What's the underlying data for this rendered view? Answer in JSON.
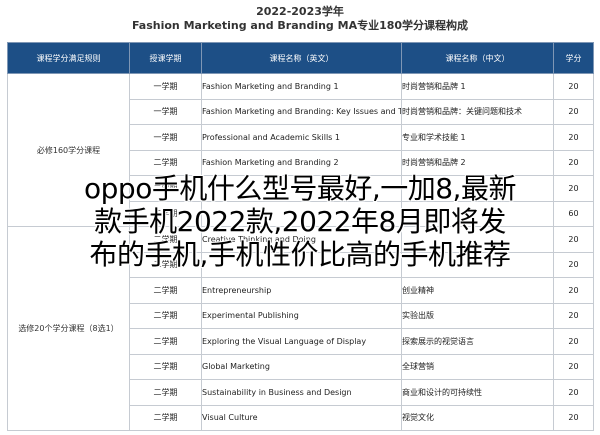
{
  "title": {
    "year": "2022-2023学年",
    "main": "Fashion Marketing and Branding MA专业180学分课程构成"
  },
  "table": {
    "headers": [
      "课程学分满足规则",
      "授课学期",
      "课程名称（英文）",
      "课程名称（中文）",
      "学分"
    ],
    "group1_label": "必修160学分课程",
    "group2_label": "选修20个学分课程（8选1）",
    "rows": [
      {
        "sem": "一学期",
        "en": "Fashion Marketing and Branding 1",
        "cn": "时尚营销和品牌 1",
        "credits": "20"
      },
      {
        "sem": "一学期",
        "en": "Fashion Marketing and Branding: Key Issues and Techniques",
        "cn": "时尚营销和品牌：关键问题和技术",
        "credits": "20"
      },
      {
        "sem": "一学期",
        "en": "Professional and Academic Skills 1",
        "cn": "专业和学术技能 1",
        "credits": "20"
      },
      {
        "sem": "二学期",
        "en": "Fashion Marketing and Branding 2",
        "cn": "时尚营销和品牌 2",
        "credits": "20"
      },
      {
        "sem": "二学期",
        "en": "",
        "cn": "",
        "credits": "20"
      },
      {
        "sem": "二学期",
        "en": "",
        "cn": "",
        "credits": "60"
      },
      {
        "sem": "二学期",
        "en": "Creative Thinking and Doing",
        "cn": "",
        "credits": "20"
      },
      {
        "sem": "二学期",
        "en": "",
        "cn": "",
        "credits": "20"
      },
      {
        "sem": "二学期",
        "en": "Entrepreneurship",
        "cn": "创业精神",
        "credits": "20"
      },
      {
        "sem": "二学期",
        "en": "Experimental Publishing",
        "cn": "实验出版",
        "credits": "20"
      },
      {
        "sem": "二学期",
        "en": "Exploring the Visual Language of Display",
        "cn": "探索展示的视觉语言",
        "credits": "20"
      },
      {
        "sem": "二学期",
        "en": "Global Marketing",
        "cn": "全球营销",
        "credits": "20"
      },
      {
        "sem": "二学期",
        "en": "Sustainability in Business and Design",
        "cn": "商业和设计的可持续性",
        "credits": "20"
      },
      {
        "sem": "二学期",
        "en": "Visual Culture",
        "cn": "视觉文化",
        "credits": "20"
      }
    ]
  },
  "overlay": {
    "line1": "oppo手机什么型号最好,一加8,最新",
    "line2": "款手机2022款,2022年8月即将发",
    "line3": "布的手机,手机性价比高的手机推荐"
  }
}
